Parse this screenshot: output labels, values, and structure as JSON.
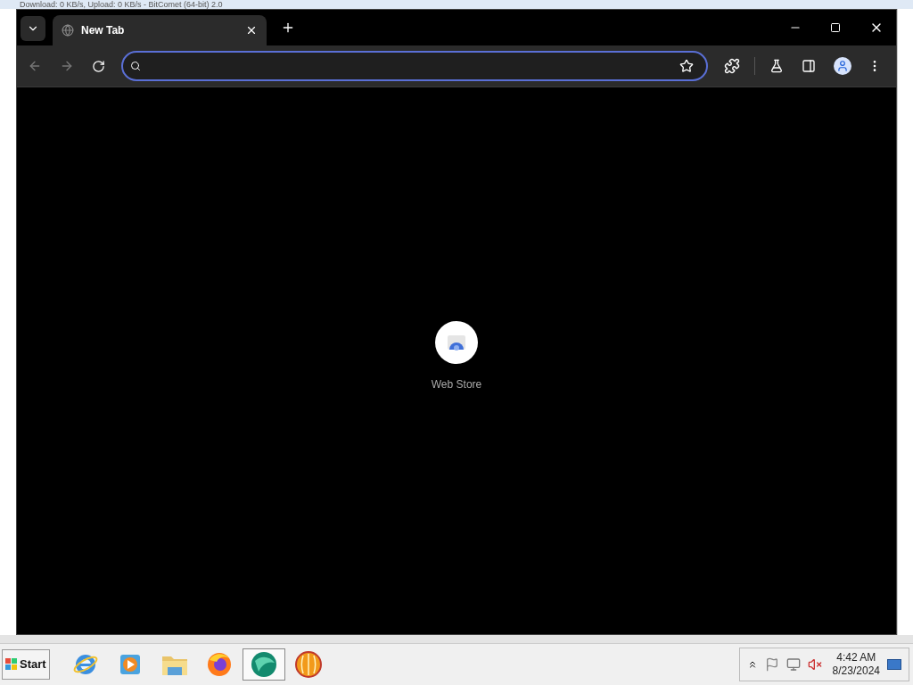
{
  "background_window": {
    "title": "Download: 0 KB/s, Upload: 0 KB/s - BitComet (64-bit) 2.0"
  },
  "browser": {
    "tabs": [
      {
        "title": "New Tab",
        "selected": true
      }
    ],
    "shortcuts": [
      {
        "label": "Web Store"
      }
    ]
  },
  "taskbar": {
    "start": "Start",
    "apps": [
      {
        "kind": "ie",
        "selected": false
      },
      {
        "kind": "media",
        "selected": false
      },
      {
        "kind": "folder",
        "selected": false
      },
      {
        "kind": "firefox",
        "selected": false
      },
      {
        "kind": "green",
        "selected": true
      },
      {
        "kind": "orange",
        "selected": false
      }
    ],
    "clock": {
      "time": "4:42 AM",
      "date": "8/23/2024"
    }
  }
}
